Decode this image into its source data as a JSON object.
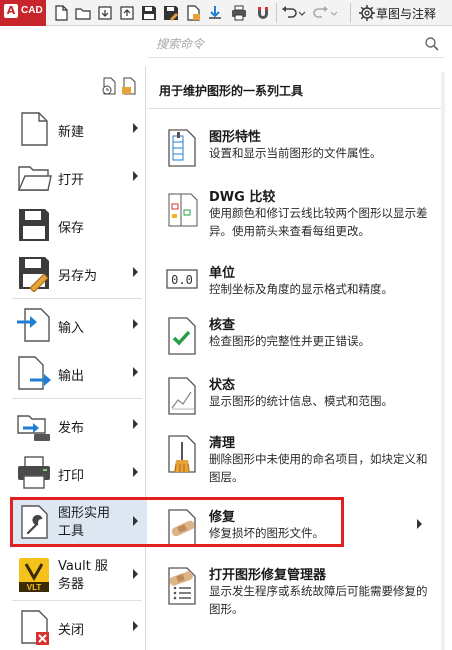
{
  "app": {
    "logo_letter": "A",
    "logo_text": "CAD"
  },
  "quick_access": {
    "icons": [
      "new-file-icon",
      "open-folder-icon",
      "open-from-web-icon",
      "save-icon",
      "save-as-icon",
      "export-icon",
      "share-icon",
      "plot-icon",
      "magnet-icon",
      "undo-icon",
      "redo-icon",
      "share-link-icon"
    ],
    "workspace_label": "草图与注释"
  },
  "search": {
    "placeholder": "搜索命令"
  },
  "left_menu": {
    "items": [
      {
        "label": "新建",
        "icon": "new-file-icon"
      },
      {
        "label": "打开",
        "icon": "open-folder-icon"
      },
      {
        "label": "保存",
        "icon": "save-icon"
      },
      {
        "label": "另存为",
        "icon": "save-as-icon"
      },
      {
        "label": "输入",
        "icon": "import-icon"
      },
      {
        "label": "输出",
        "icon": "export-icon"
      },
      {
        "label": "发布",
        "icon": "publish-icon"
      },
      {
        "label": "打印",
        "icon": "printer-icon"
      },
      {
        "label_line1": "图形实用",
        "label_line2": "工具",
        "icon": "wrench-icon"
      },
      {
        "label_line1": "Vault 服",
        "label_line2": "务器",
        "icon": "vault-icon",
        "badge": "VLT"
      },
      {
        "label": "关闭",
        "icon": "close-file-icon"
      }
    ]
  },
  "panel": {
    "title": "用于维护图形的一系列工具",
    "items": [
      {
        "title": "图形特性",
        "desc": "设置和显示当前图形的文件属性。",
        "icon": "drawing-properties-icon"
      },
      {
        "title": "DWG 比较",
        "desc": "使用颜色和修订云线比较两个图形以显示差异。使用箭头来查看每组更改。",
        "icon": "dwg-compare-icon"
      },
      {
        "title": "单位",
        "desc": "控制坐标及角度的显示格式和精度。",
        "icon": "units-icon",
        "icon_text": "0.0"
      },
      {
        "title": "核查",
        "desc": "检查图形的完整性并更正错误。",
        "icon": "audit-icon"
      },
      {
        "title": "状态",
        "desc": "显示图形的统计信息、模式和范围。",
        "icon": "status-icon"
      },
      {
        "title": "清理",
        "desc": "删除图形中未使用的命名项目，如块定义和图层。",
        "icon": "purge-icon"
      },
      {
        "title": "修复",
        "desc": "修复损坏的图形文件。",
        "icon": "recover-icon"
      },
      {
        "title": "打开图形修复管理器",
        "desc": "显示发生程序或系统故障后可能需要修复的图形。",
        "icon": "recovery-manager-icon"
      }
    ]
  },
  "colors": {
    "app_red": "#c8242b",
    "highlight_red": "#e0211f",
    "accent_blue": "#1f7fd6",
    "selected_bg": "#dde7f2"
  }
}
